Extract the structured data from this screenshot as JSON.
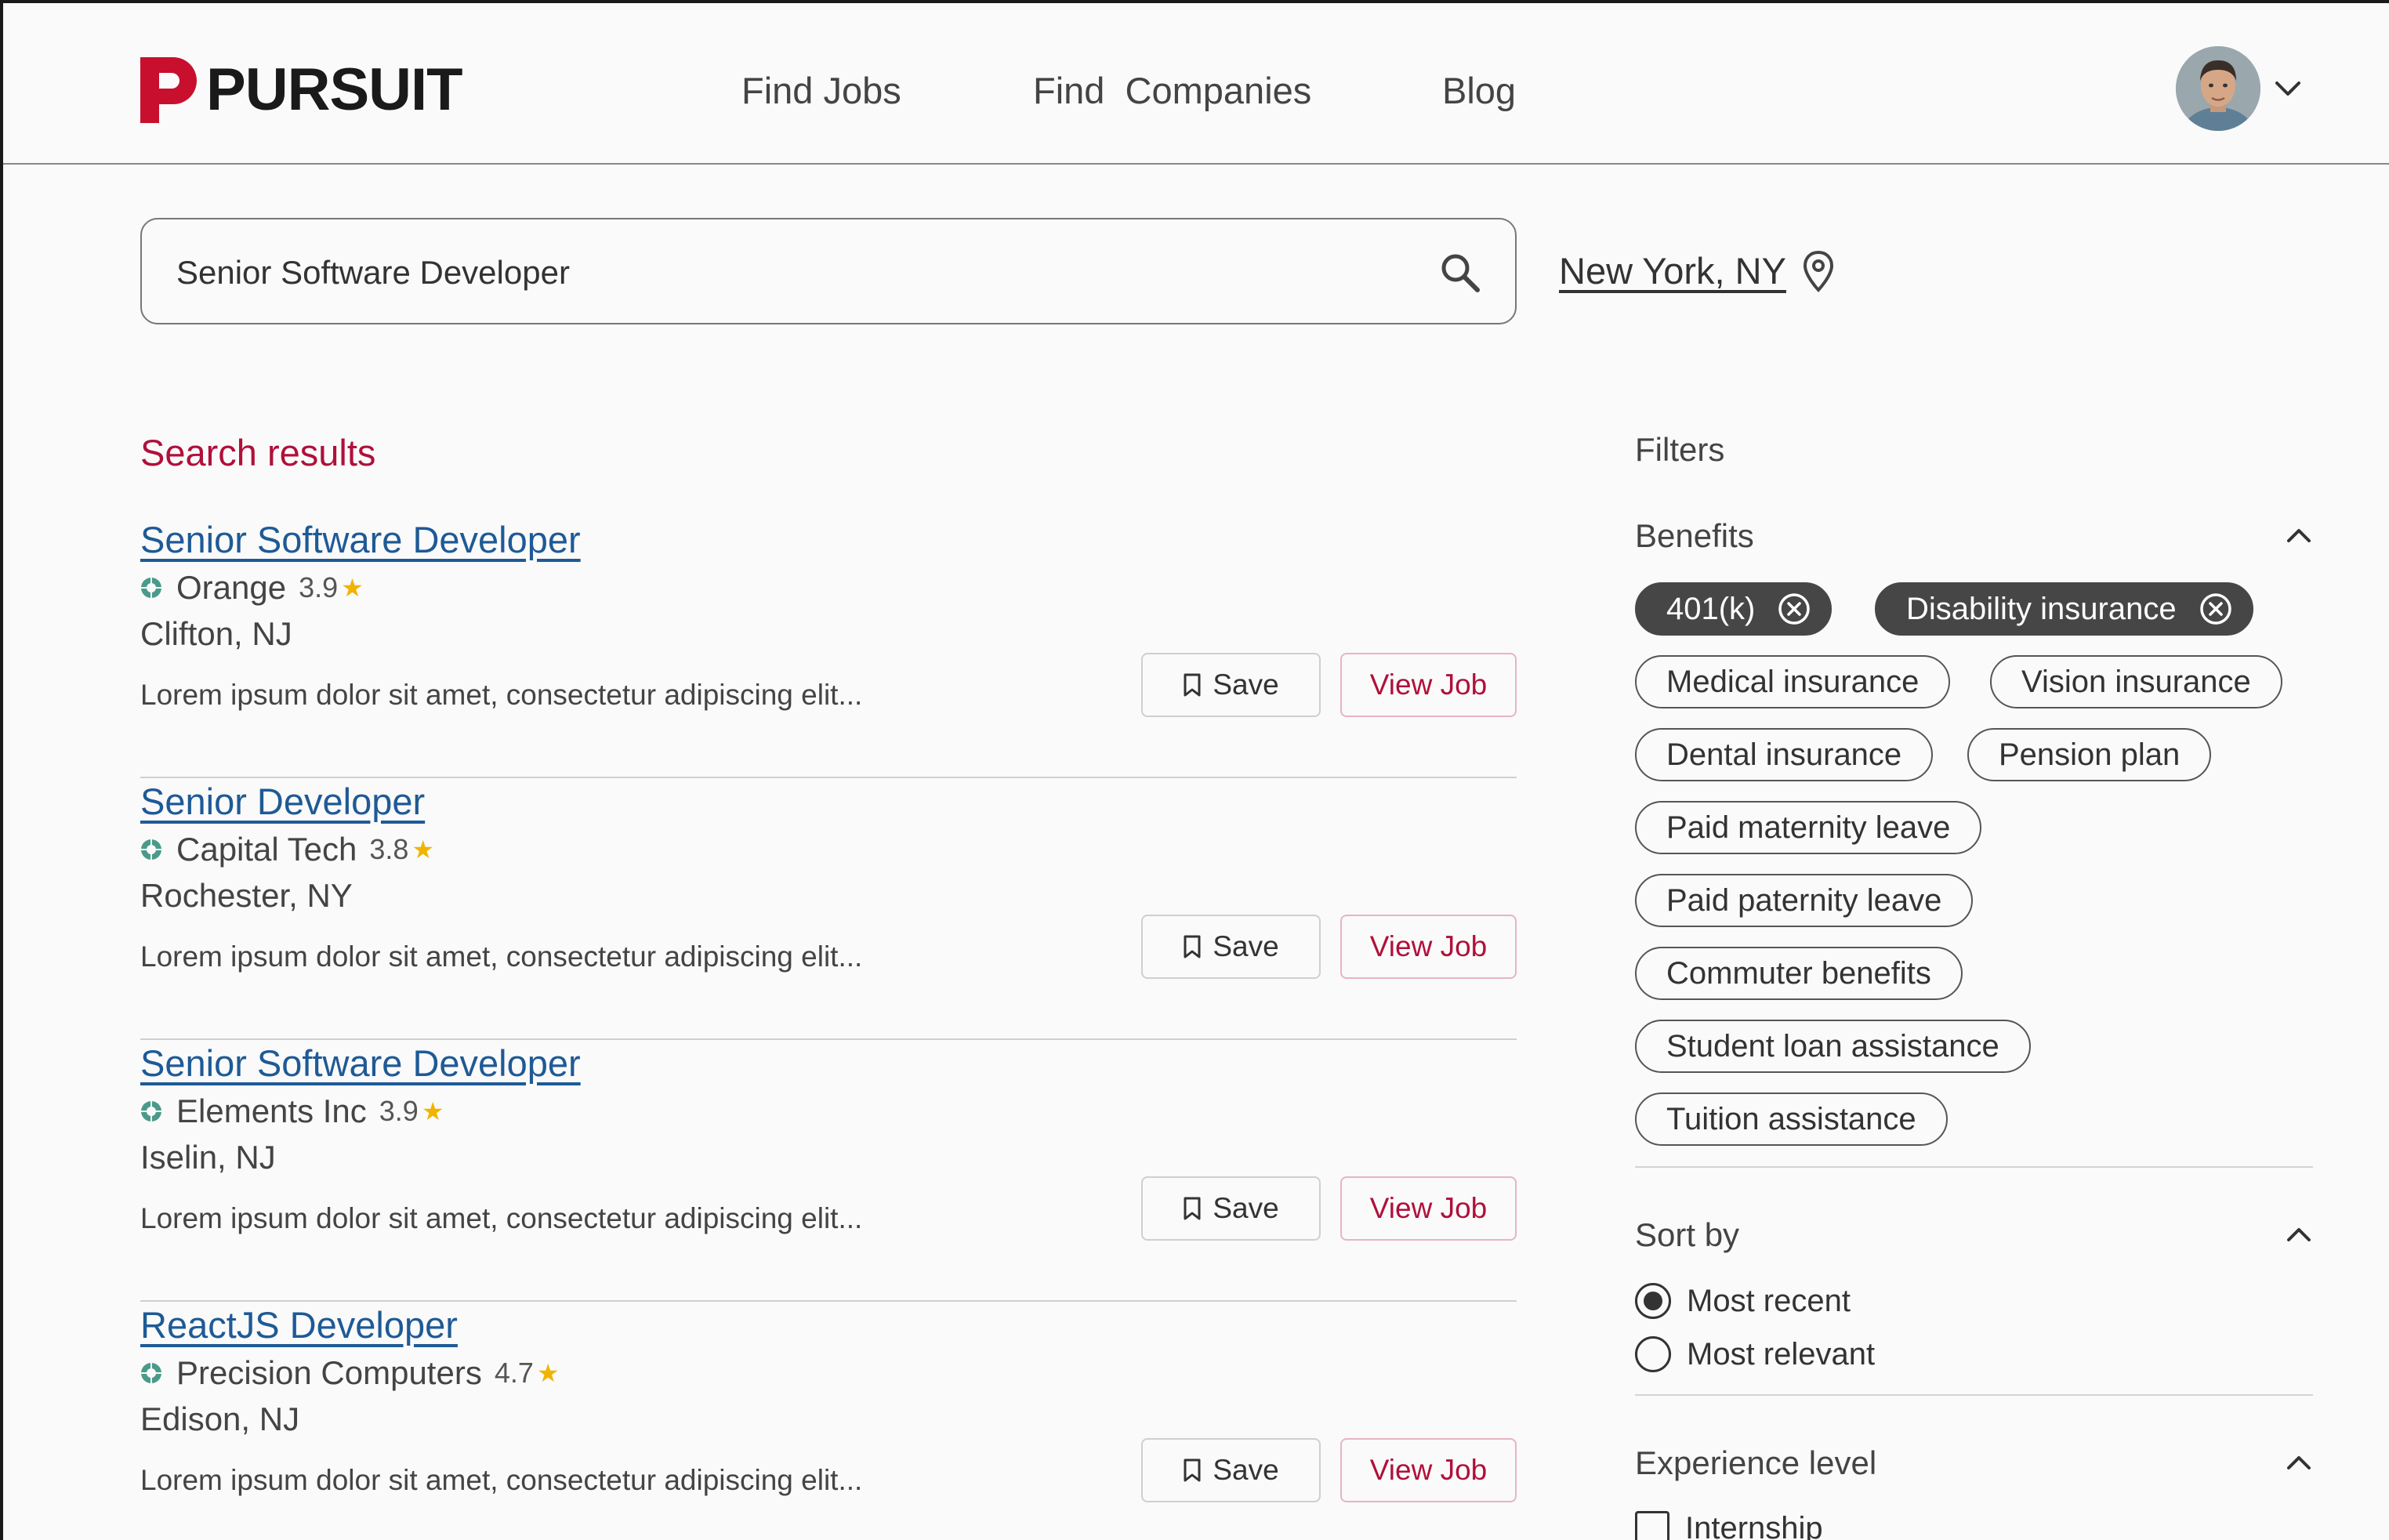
{
  "header": {
    "logo_text": "PURSUIT",
    "nav": [
      "Find Jobs",
      "Find  Companies",
      "Blog"
    ]
  },
  "search": {
    "query": "Senior Software Developer",
    "location": "New York, NY"
  },
  "results": {
    "title": "Search results",
    "save_label": "Save",
    "view_label": "View Job",
    "jobs": [
      {
        "title": "Senior Software Developer",
        "company": "Orange",
        "rating": "3.9",
        "location": "Clifton, NJ",
        "description": "Lorem ipsum dolor sit amet, consectetur adipiscing elit..."
      },
      {
        "title": "Senior Developer",
        "company": "Capital Tech",
        "rating": "3.8",
        "location": "Rochester, NY",
        "description": "Lorem ipsum dolor sit amet, consectetur adipiscing elit..."
      },
      {
        "title": "Senior Software Developer",
        "company": "Elements Inc",
        "rating": "3.9",
        "location": "Iselin, NJ",
        "description": "Lorem ipsum dolor sit amet, consectetur adipiscing elit..."
      },
      {
        "title": "ReactJS Developer",
        "company": "Precision Computers",
        "rating": "4.7",
        "location": "Edison, NJ",
        "description": "Lorem ipsum dolor sit amet, consectetur adipiscing elit..."
      }
    ]
  },
  "filters": {
    "title": "Filters",
    "benefits": {
      "label": "Benefits",
      "chips": [
        {
          "label": "401(k)",
          "selected": true
        },
        {
          "label": "Disability insurance",
          "selected": true
        },
        {
          "label": "Medical insurance",
          "selected": false
        },
        {
          "label": "Vision insurance",
          "selected": false
        },
        {
          "label": "Dental insurance",
          "selected": false
        },
        {
          "label": "Pension plan",
          "selected": false
        },
        {
          "label": "Paid maternity leave",
          "selected": false
        },
        {
          "label": "Paid paternity leave",
          "selected": false
        },
        {
          "label": "Commuter benefits",
          "selected": false
        },
        {
          "label": "Student loan assistance",
          "selected": false
        },
        {
          "label": "Tuition assistance",
          "selected": false
        }
      ]
    },
    "sort": {
      "label": "Sort by",
      "options": [
        {
          "label": "Most recent",
          "checked": true
        },
        {
          "label": "Most relevant",
          "checked": false
        }
      ]
    },
    "experience": {
      "label": "Experience level",
      "options": [
        {
          "label": "Internship",
          "checked": false
        }
      ]
    }
  },
  "colors": {
    "brand": "#c8102e",
    "link": "#1e5a96",
    "accent_text": "#b0103a",
    "star": "#f0b400",
    "company_logo": "#4a9a8a"
  },
  "icons": [
    "search-icon",
    "location-pin-icon",
    "bookmark-icon",
    "star-icon",
    "chevron-up-icon",
    "chevron-down-icon",
    "close-circle-icon"
  ]
}
